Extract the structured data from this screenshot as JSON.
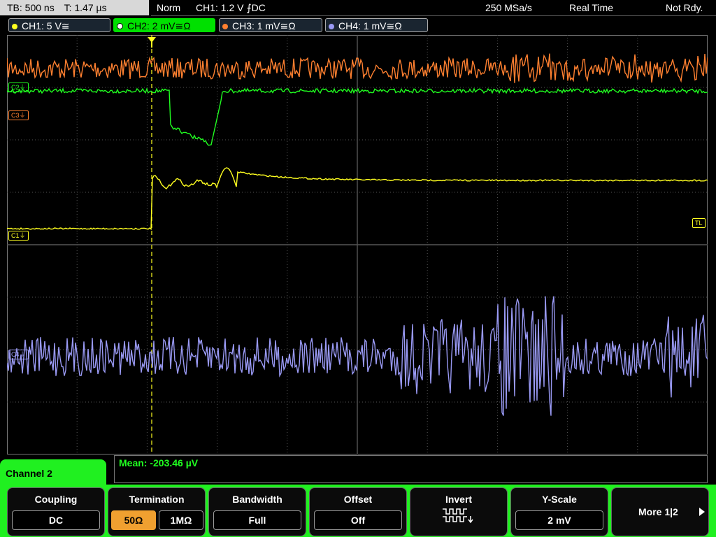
{
  "status": {
    "timebase": "TB: 500 ns",
    "trigger_time": "T: 1.47 µs",
    "mode": "Norm",
    "trigger": "CH1: 1.2 V ⨍DC",
    "sample_rate": "250 MSa/s",
    "acquisition": "Real Time",
    "ready": "Not Rdy."
  },
  "channels": [
    {
      "label": "CH1: 5 V≅",
      "color": "#ffff20"
    },
    {
      "label": "CH2: 2 mV≅Ω",
      "color": "#20ff20",
      "active": true
    },
    {
      "label": "CH3: 1 mV≅Ω",
      "color": "#ff8030"
    },
    {
      "label": "CH4: 1 mV≅Ω",
      "color": "#9a9af5"
    }
  ],
  "markers": {
    "c1": "C1⏚",
    "c2": "C2⏚",
    "c3": "C3⏚",
    "c4": "C4⏚",
    "tl": "TL"
  },
  "measurement": {
    "mean": "Mean: -203.46 µV"
  },
  "menu": {
    "title": "Channel 2",
    "coupling": {
      "label": "Coupling",
      "value": "DC"
    },
    "termination": {
      "label": "Termination",
      "option_a": "50Ω",
      "option_b": "1MΩ"
    },
    "bandwidth": {
      "label": "Bandwidth",
      "value": "Full"
    },
    "offset": {
      "label": "Offset",
      "value": "Off"
    },
    "invert": {
      "label": "Invert"
    },
    "yscale": {
      "label": "Y-Scale",
      "value": "2 mV"
    },
    "more": {
      "label": "More 1|2"
    }
  }
}
